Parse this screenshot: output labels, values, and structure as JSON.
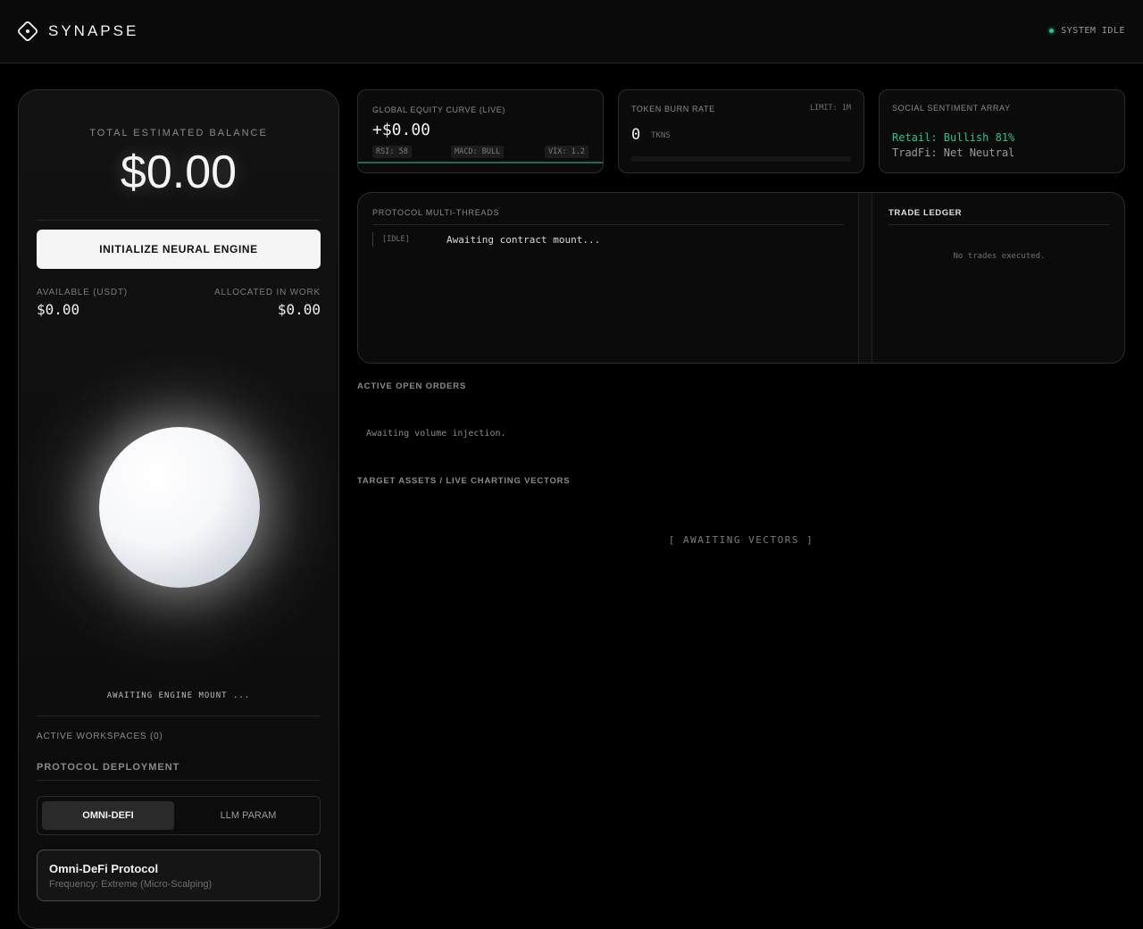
{
  "header": {
    "brand": "SYNAPSE",
    "system_status": "SYSTEM IDLE",
    "status_color": "#22c58b"
  },
  "left_panel": {
    "balance_label": "TOTAL ESTIMATED BALANCE",
    "balance_value": "$0.00",
    "init_button": "INITIALIZE NEURAL ENGINE",
    "available_label": "AVAILABLE (USDT)",
    "available_value": "$0.00",
    "allocated_label": "ALLOCATED IN WORK",
    "allocated_value": "$0.00",
    "engine_status": "AWAITING ENGINE MOUNT ...",
    "workspaces": "ACTIVE WORKSPACES (0)",
    "protocol_title": "PROTOCOL DEPLOYMENT",
    "tabs": [
      {
        "label": "OMNI-DEFI",
        "active": true
      },
      {
        "label": "LLM PARAM",
        "active": false
      }
    ],
    "protocol_card": {
      "name": "Omni-DeFi Protocol",
      "frequency": "Frequency: Extreme (Micro-Scalping)"
    }
  },
  "equity": {
    "label": "GLOBAL EQUITY CURVE (LIVE)",
    "value": "+$0.00",
    "chips": [
      "RSI: 58",
      "MACD: BULL",
      "VIX: 1.2"
    ]
  },
  "burn": {
    "label": "TOKEN BURN RATE",
    "limit": "LIMIT: 1M",
    "value": "0",
    "unit": "TKNS",
    "fill_fraction": 0
  },
  "sentiment": {
    "label": "SOCIAL SENTIMENT ARRAY",
    "retail": "Retail: Bullish 81%",
    "tradfi": "TradFi: Net Neutral"
  },
  "threads": {
    "label": "PROTOCOL MULTI-THREADS",
    "tag": "[IDLE]",
    "message": "Awaiting contract mount..."
  },
  "ledger": {
    "label": "TRADE LEDGER",
    "empty": "No trades executed."
  },
  "orders": {
    "label": "ACTIVE OPEN ORDERS",
    "empty": "Awaiting volume injection."
  },
  "vectors": {
    "label": "TARGET ASSETS / LIVE CHARTING VECTORS",
    "empty": "[ AWAITING VECTORS ]"
  }
}
